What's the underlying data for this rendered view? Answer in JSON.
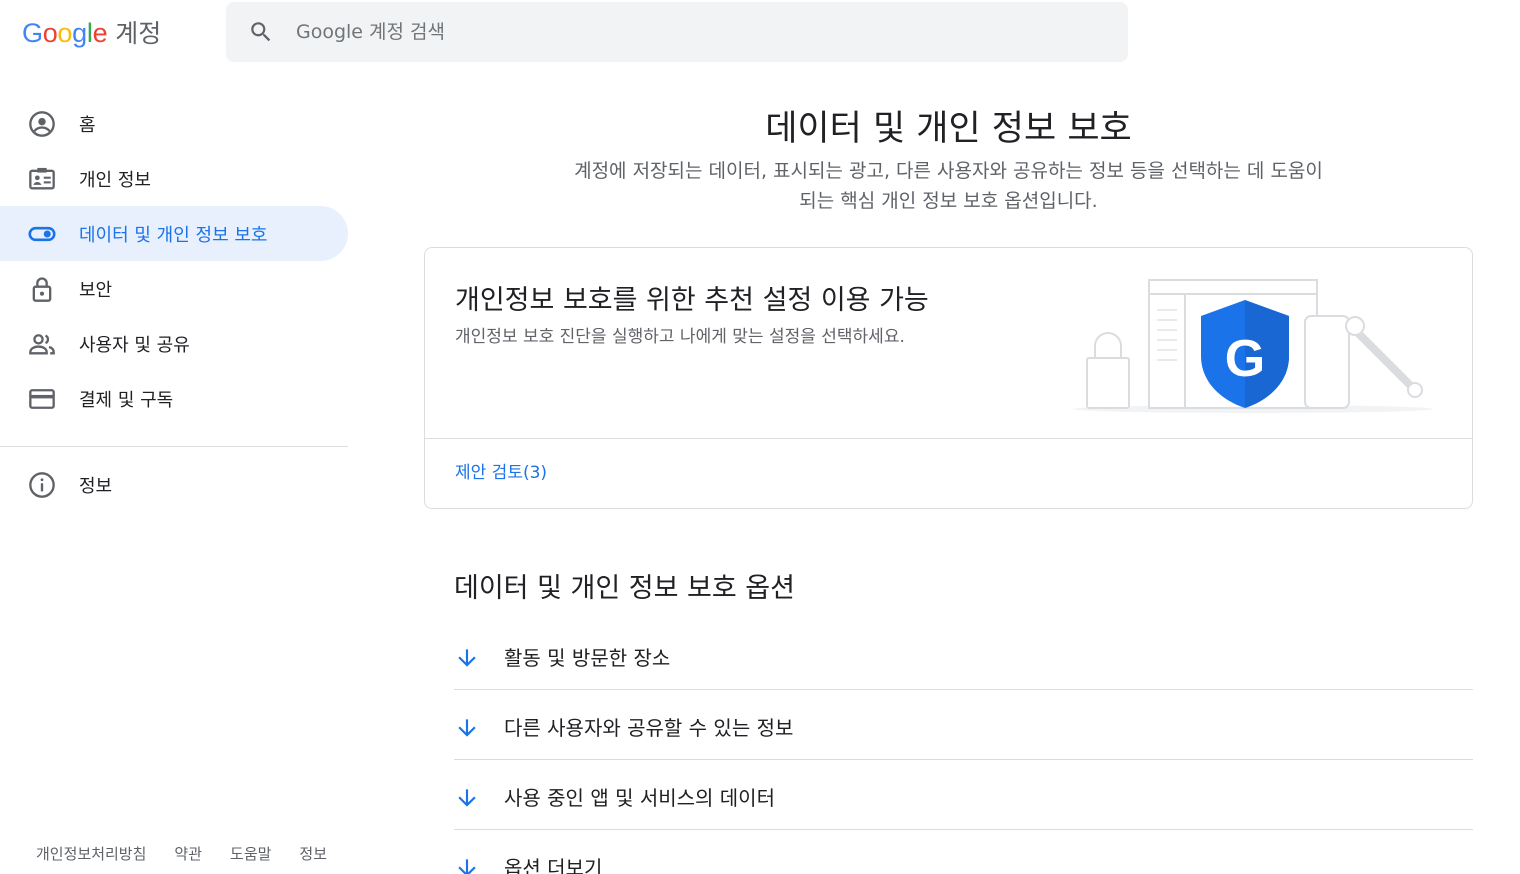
{
  "header": {
    "logo_text": "Google",
    "logo_suffix": "계정",
    "search_placeholder": "Google 계정 검색"
  },
  "sidebar": {
    "items": [
      {
        "label": "홈",
        "icon": "account-circle-icon"
      },
      {
        "label": "개인 정보",
        "icon": "id-card-icon"
      },
      {
        "label": "데이터 및 개인 정보 보호",
        "icon": "toggle-icon",
        "active": true
      },
      {
        "label": "보안",
        "icon": "lock-icon"
      },
      {
        "label": "사용자 및 공유",
        "icon": "people-icon"
      },
      {
        "label": "결제 및 구독",
        "icon": "credit-card-icon"
      }
    ],
    "info_item": {
      "label": "정보",
      "icon": "info-icon"
    }
  },
  "footer": {
    "links": [
      "개인정보처리방침",
      "약관",
      "도움말",
      "정보"
    ]
  },
  "main": {
    "title": "데이터 및 개인 정보 보호",
    "subtitle": "계정에 저장되는 데이터, 표시되는 광고, 다른 사용자와 공유하는 정보 등을 선택하는 데 도움이 되는 핵심 개인 정보 보호 옵션입니다.",
    "card": {
      "title": "개인정보 보호를 위한 추천 설정 이용 가능",
      "description": "개인정보 보호 진단을 실행하고 나에게 맞는 설정을 선택하세요.",
      "link": "제안 검토(3)"
    },
    "section_title": "데이터 및 개인 정보 보호 옵션",
    "options": [
      "활동 및 방문한 장소",
      "다른 사용자와 공유할 수 있는 정보",
      "사용 중인 앱 및 서비스의 데이터",
      "옵션 더보기"
    ]
  },
  "colors": {
    "accent": "#1a73e8",
    "active_bg": "#e8f0fe",
    "divider": "#dadce0",
    "secondary_text": "#5f6368"
  }
}
